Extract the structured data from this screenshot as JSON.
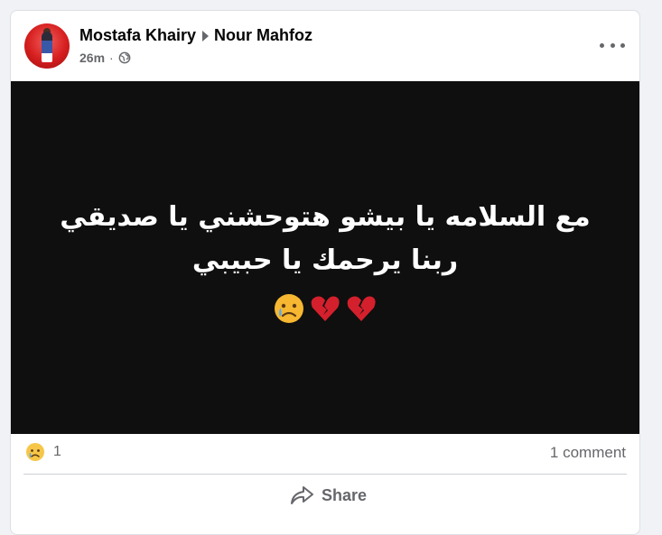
{
  "post": {
    "author": "Mostafa Khairy",
    "recipient": "Nour Mahfoz",
    "time": "26m",
    "privacy_icon": "globe-icon",
    "more_icon": "more-options-icon",
    "text_line1": "مع السلامه يا بيشو هتوحشني يا صديقي",
    "text_line2": "ربنا يرحمك يا حبيبي",
    "emojis": [
      "crying-face",
      "broken-heart",
      "broken-heart"
    ],
    "background_color": "#0f0f0f"
  },
  "footer": {
    "reaction_icon": "sad-reaction-icon",
    "reaction_count": "1",
    "comment_count": "1 comment",
    "share_label": "Share"
  }
}
